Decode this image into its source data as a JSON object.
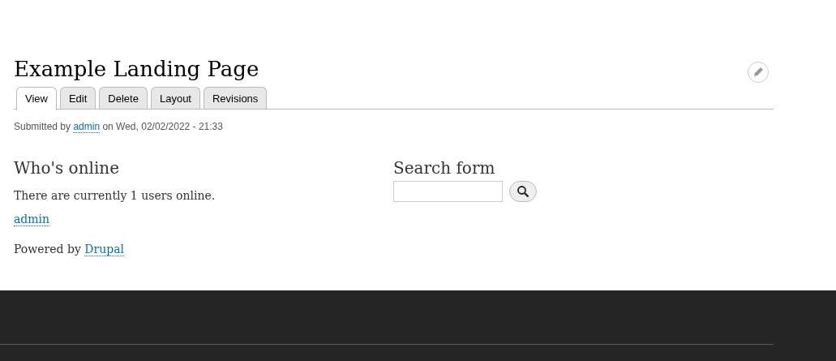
{
  "page_title": "Example Landing Page",
  "tabs": [
    {
      "label": "View",
      "selected": true
    },
    {
      "label": "Edit",
      "selected": false
    },
    {
      "label": "Delete",
      "selected": false
    },
    {
      "label": "Layout",
      "selected": false
    },
    {
      "label": "Revisions",
      "selected": false
    }
  ],
  "submitted": {
    "before": "Submitted by",
    "author": "admin",
    "after": "on Wed, 02/02/2022 - 21:33"
  },
  "whos_online": {
    "title": "Who's online",
    "text": "There are currently 1 users online.",
    "users": [
      "admin"
    ]
  },
  "powered_by": {
    "before": "Powered by",
    "link": "Drupal"
  },
  "search": {
    "title": "Search form"
  }
}
